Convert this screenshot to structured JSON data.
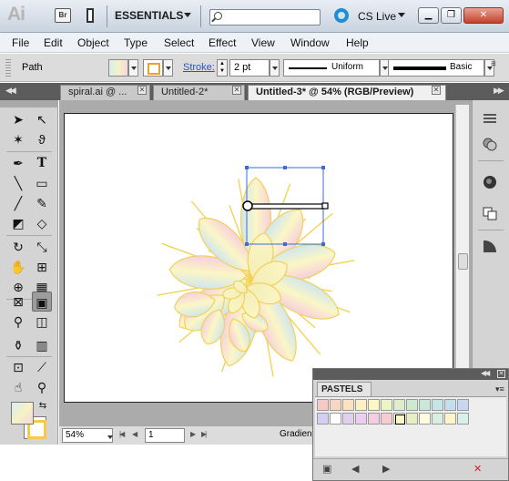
{
  "app": {
    "logo": "Ai",
    "bridge_label": "Br",
    "workspace": "ESSENTIALS",
    "search_placeholder": "",
    "cs_live": "CS Live",
    "window_controls": {
      "minimize": "▁",
      "maximize": "❐",
      "close": "✕"
    }
  },
  "menu": [
    "File",
    "Edit",
    "Object",
    "Type",
    "Select",
    "Effect",
    "View",
    "Window",
    "Help"
  ],
  "control": {
    "selection_label": "Path",
    "stroke_label": "Stroke:",
    "stroke_weight": "2 pt",
    "profile_label": "Uniform",
    "brush_label": "Basic"
  },
  "tabs": [
    {
      "label": "spiral.ai @ ...",
      "active": false
    },
    {
      "label": "Untitled-2*",
      "active": false
    },
    {
      "label": "Untitled-3* @ 54% (RGB/Preview)",
      "active": true
    }
  ],
  "tools": [
    "selection-tool",
    "direct-selection-tool",
    "magic-wand-tool",
    "lasso-tool",
    "pen-tool",
    "type-tool",
    "line-tool",
    "rectangle-tool",
    "paintbrush-tool",
    "pencil-tool",
    "blob-brush-tool",
    "eraser-tool",
    "rotate-tool",
    "scale-tool",
    "warp-tool",
    "free-transform-tool",
    "shape-builder-tool",
    "perspective-grid-tool",
    "mesh-tool",
    "gradient-tool",
    "eyedropper-tool",
    "blend-tool",
    "symbol-sprayer-tool",
    "column-graph-tool",
    "artboard-tool",
    "slice-tool",
    "hand-tool",
    "zoom-tool"
  ],
  "colors": {
    "fill_gradient": [
      "#d6eef3",
      "#f6f2c4",
      "#f6d6e0"
    ],
    "stroke": "#f5c94a",
    "selection": "#3d6bd8"
  },
  "status": {
    "zoom": "54%",
    "page": "1",
    "info": "Gradien"
  },
  "swatch_panel": {
    "title": "PASTELS",
    "row1": [
      "#f7c9c4",
      "#f9d6c1",
      "#fbe3c0",
      "#fdf0c3",
      "#fbf8c3",
      "#eef5c5",
      "#dcefc9",
      "#cfe9cf",
      "#c9e7db",
      "#c6e5e8",
      "#c4def0",
      "#c7d7f2"
    ],
    "row2": [
      "#d2d0f2",
      "#ffffff",
      "#e2cff0",
      "#efcdef",
      "#f5cde0",
      "#f7cbd2",
      "#fdf7c8",
      "#e5efc3",
      "#fdfbe0",
      "#d8efe0",
      "#fff3c9",
      "#d8f0ea"
    ],
    "selected_index": 6
  }
}
